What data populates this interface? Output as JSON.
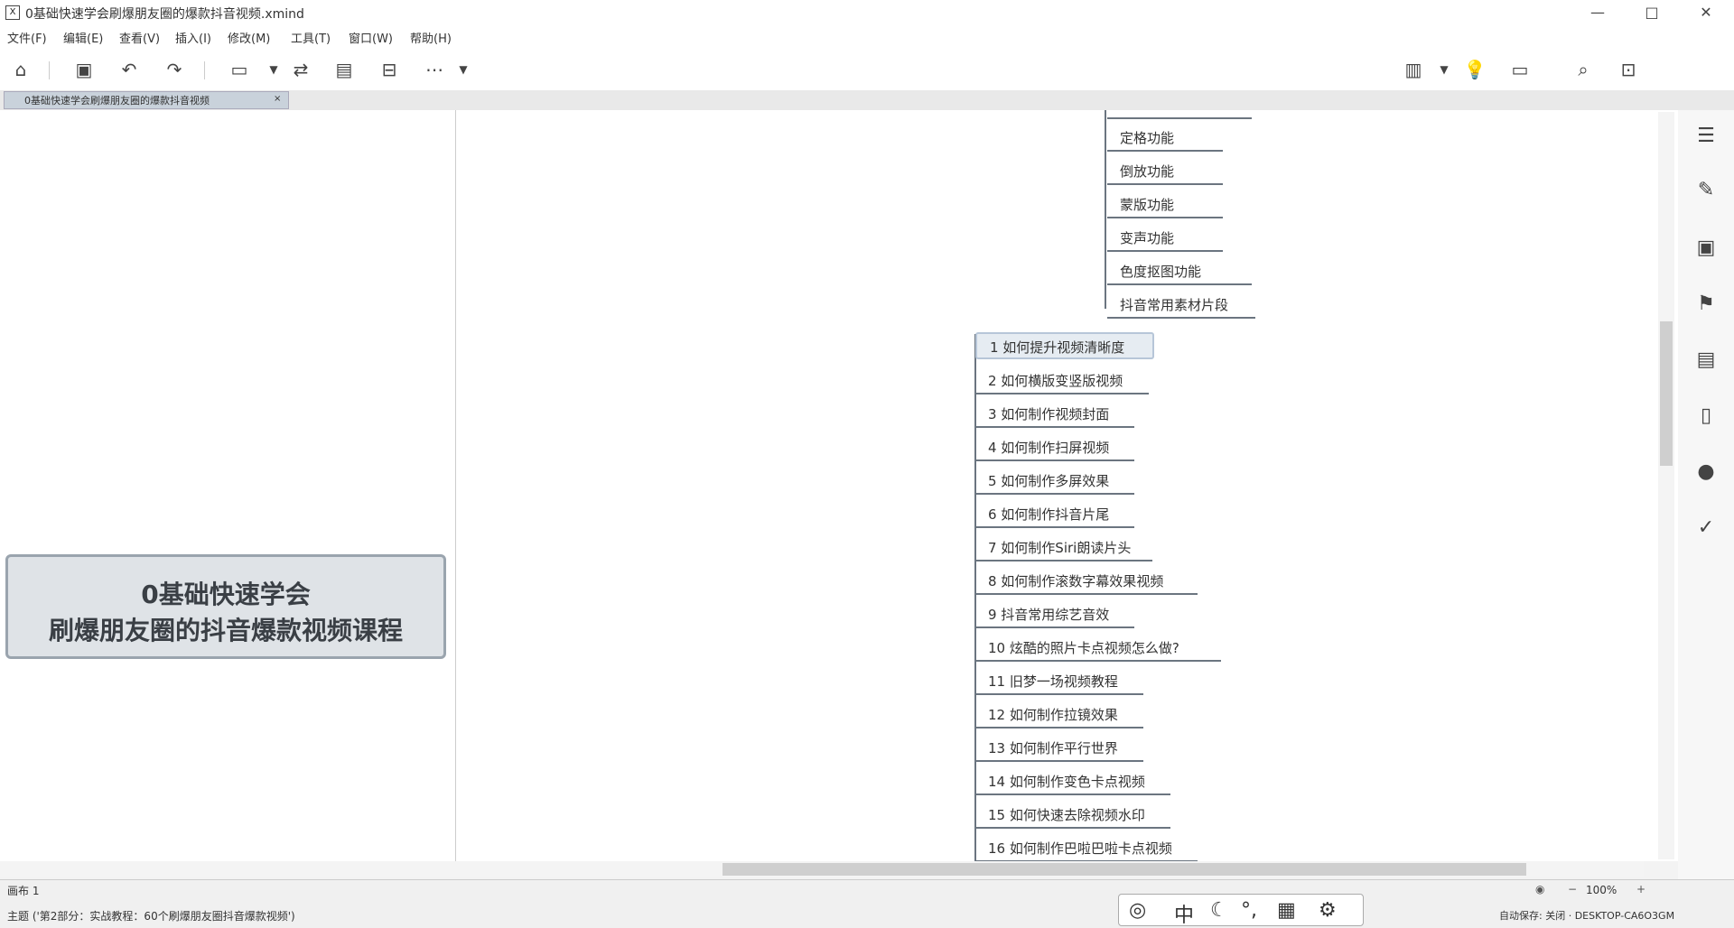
{
  "window": {
    "title": "0基础快速学会刷爆朋友圈的爆款抖音视频.xmind",
    "minimize": "—",
    "maximize": "□",
    "close": "✕"
  },
  "menu": [
    "文件(F)",
    "编辑(E)",
    "查看(V)",
    "插入(I)",
    "修改(M)",
    "工具(T)",
    "窗口(W)",
    "帮助(H)"
  ],
  "tab": {
    "label": "0基础快速学会刷爆朋友圈的爆款抖音视频",
    "close": "×"
  },
  "central_topic": {
    "line1": "0基础快速学会",
    "line2": "刷爆朋友圈的抖音爆款视频课程"
  },
  "subtopics": [
    "定格功能",
    "倒放功能",
    "蒙版功能",
    "变声功能",
    "色度抠图功能",
    "抖音常用素材片段"
  ],
  "topics": [
    "1 如何提升视频清晰度",
    "2 如何横版变竖版视频",
    "3 如何制作视频封面",
    "4 如何制作扫屏视频",
    "5 如何制作多屏效果",
    "6 如何制作抖音片尾",
    "7 如何制作Siri朗读片头",
    "8 如何制作滚数字幕效果视频",
    "9 抖音常用综艺音效",
    "10 炫酷的照片卡点视频怎么做?",
    "11 旧梦一场视频教程",
    "12 如何制作拉镜效果",
    "13 如何制作平行世界",
    "14 如何制作变色卡点视频",
    "15 如何快速去除视频水印",
    "16 如何制作巴啦巴啦卡点视频"
  ],
  "sheet": {
    "label": "画布 1",
    "zoom": "100%"
  },
  "status": {
    "left": "主题 ('第2部分：实战教程：60个刷爆朋友圈抖音爆款视频')",
    "right": "自动保存: 关闭 · DESKTOP-CA6O3GM"
  },
  "icons": {
    "home": "home-icon",
    "save": "save-icon",
    "undo": "undo-icon",
    "redo": "redo-icon"
  },
  "ime": {
    "mode": "中"
  }
}
